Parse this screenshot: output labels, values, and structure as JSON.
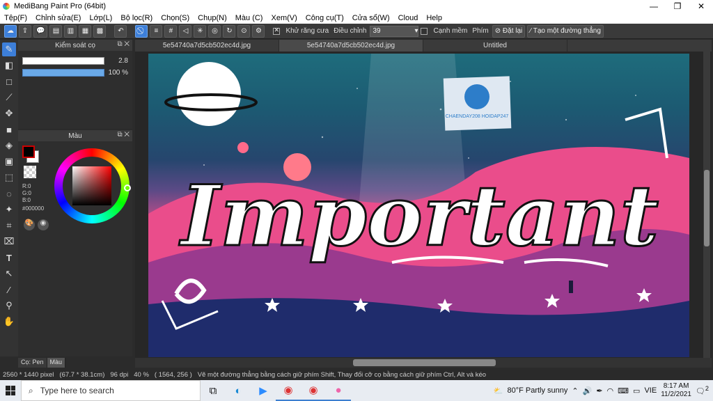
{
  "window": {
    "title": "MediBang Paint Pro (64bit)",
    "minimize": "—",
    "maximize": "❐",
    "close": "✕"
  },
  "menu": [
    "Tệp(F)",
    "Chỉnh sửa(E)",
    "Lớp(L)",
    "Bộ lọc(R)",
    "Chọn(S)",
    "Chụp(N)",
    "Màu (C)",
    "Xem(V)",
    "Công cụ(T)",
    "Cửa sổ(W)",
    "Cloud",
    "Help"
  ],
  "toolbar": {
    "antialias_label": "Khử răng cưa",
    "adjust_label": "Điều chỉnh",
    "adjust_value": "39",
    "soft_edge_label": "Cạnh mềm",
    "keys_label": "Phím",
    "reset_label": "Đặt lại",
    "line_label": "Tạo một đường thẳng"
  },
  "brush_panel": {
    "title": "Kiểm soát cọ",
    "size_value": "2.8",
    "opacity_value": "100 %"
  },
  "color_panel": {
    "title": "Màu",
    "r": "R:0",
    "g": "G:0",
    "b": "B:0",
    "hex": "#000000",
    "fg_color": "#000000",
    "bg_color": "#ffffff",
    "accent": "#cc0000"
  },
  "tabs": [
    {
      "label": "5e54740a7d5cb502ec4d.jpg"
    },
    {
      "label": "5e54740a7d5cb502ec4d.jpg"
    },
    {
      "label": "Untitled"
    }
  ],
  "canvas": {
    "word": "Important",
    "watermark": "CHAENDAY208 HOIDAP247"
  },
  "bottom_tabs": {
    "brush": "Cọ: Pen",
    "color": "Màu"
  },
  "status": {
    "size": "2560 * 1440 pixel",
    "cm": "(67.7 * 38.1cm)",
    "dpi": "96 dpi",
    "zoom": "40 %",
    "coords": "( 1564, 256 )",
    "hint": "Vẽ một đường thẳng bằng cách giữ phím Shift, Thay đổi cỡ cọ bằng cách giữ phím Ctrl, Alt và kéo"
  },
  "taskbar": {
    "search_placeholder": "Type here to search",
    "weather": "80°F  Partly sunny",
    "lang": "VIE",
    "time": "8:17 AM",
    "date": "11/2/2021",
    "notif_count": "2"
  }
}
